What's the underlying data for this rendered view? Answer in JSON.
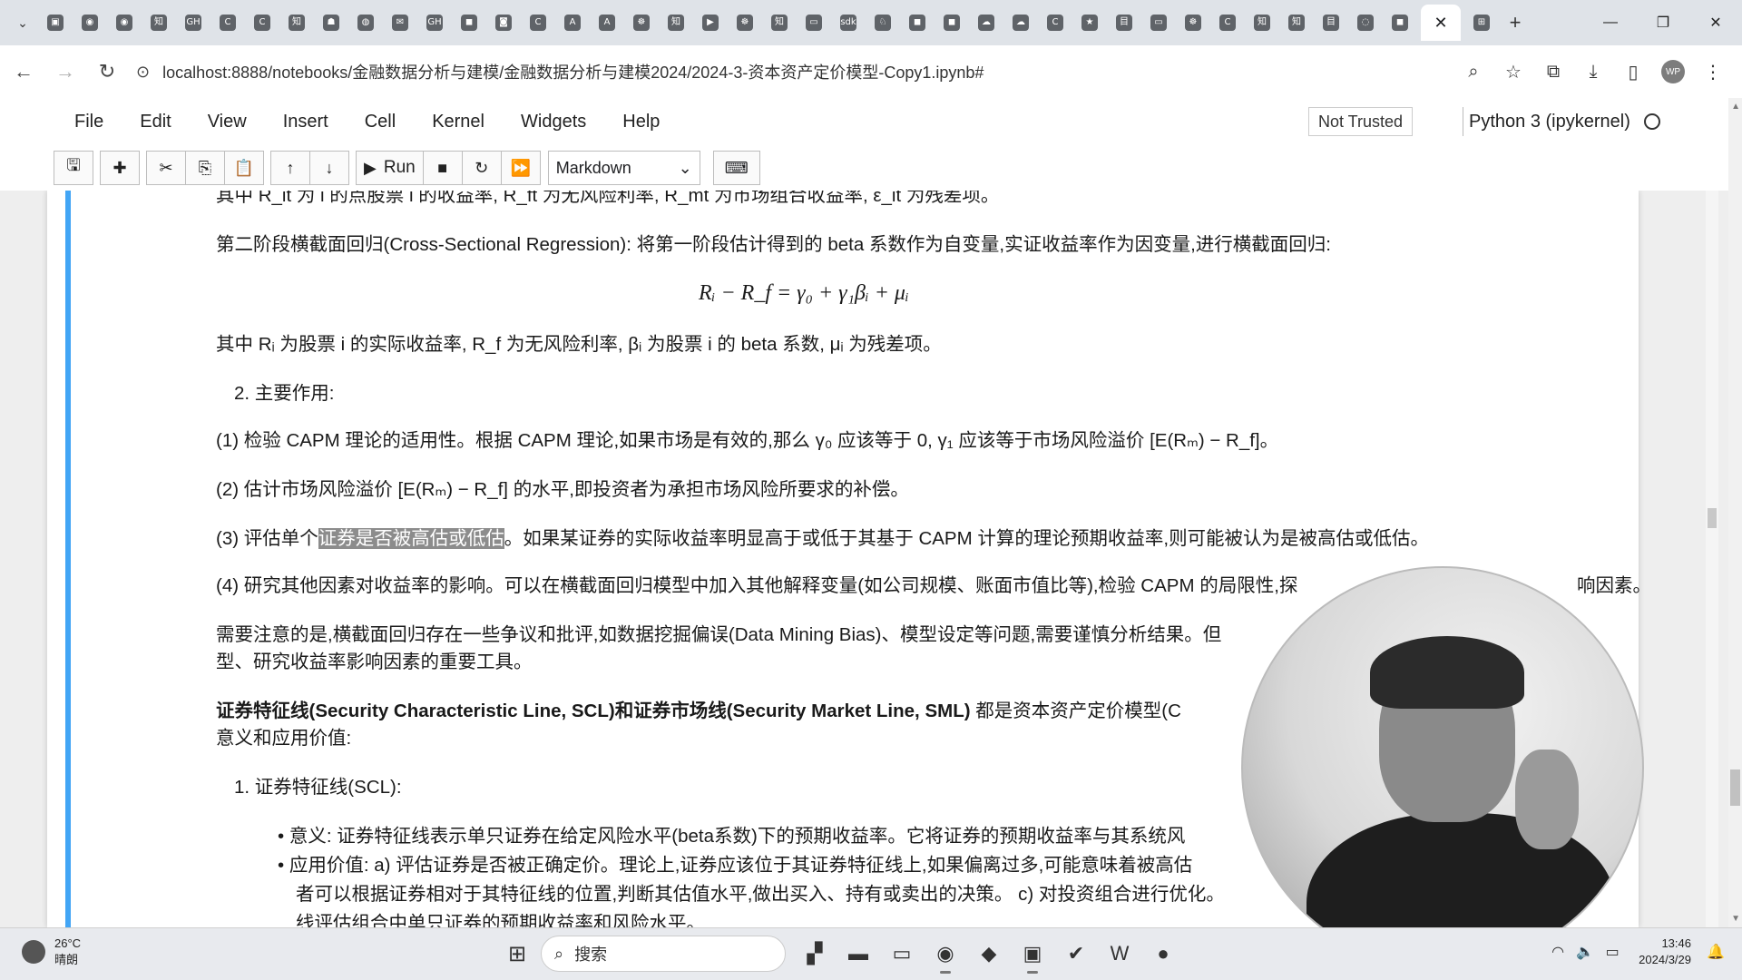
{
  "browser": {
    "tab_icons": [
      "▾",
      "▣",
      "◉",
      "◉",
      "知",
      "GH",
      "C",
      "C",
      "知",
      "☗",
      "◍",
      "✉",
      "GH",
      "◼",
      "◙",
      "C",
      "A",
      "A",
      "☸",
      "知",
      "▶",
      "☸",
      "知",
      "▭",
      "sdk",
      "♘",
      "◼",
      "◼",
      "☁",
      "☁",
      "C",
      "★",
      "目",
      "▭",
      "☸",
      "C",
      "知",
      "知",
      "目",
      "◌",
      "◼"
    ],
    "active_tab_close": "✕",
    "new_tab": "+",
    "window_controls": [
      "—",
      "❐",
      "✕"
    ],
    "url": "localhost:8888/notebooks/金融数据分析与建模/金融数据分析与建模2024/2024-3-资本资产定价模型-Copy1.ipynb#",
    "nav_back": "←",
    "nav_forward": "→",
    "nav_reload": "↻"
  },
  "menu": {
    "items": [
      "File",
      "Edit",
      "View",
      "Insert",
      "Cell",
      "Kernel",
      "Widgets",
      "Help"
    ],
    "trusted_label": "Not Trusted",
    "kernel_label": "Python 3 (ipykernel)"
  },
  "toolbar": {
    "run_label": "Run",
    "cell_type": "Markdown"
  },
  "content": {
    "line0": "其中 R_it 为 i 的点股票 i 的收益率, R_ft 为无风险利率, R_mt 为市场组合收益率, ε_it 为残差项。",
    "line1": "第二阶段横截面回归(Cross-Sectional Regression): 将第一阶段估计得到的 beta 系数作为自变量,实证收益率作为因变量,进行横截面回归:",
    "equation": "Rᵢ − R_f = γ₀ + γ₁βᵢ + μᵢ",
    "line2": "其中 Rᵢ 为股票 i 的实际收益率, R_f 为无风险利率, βᵢ 为股票 i 的 beta 系数, μᵢ 为残差项。",
    "line3": "2. 主要作用:",
    "line4": "(1) 检验 CAPM 理论的适用性。根据 CAPM 理论,如果市场是有效的,那么 γ₀ 应该等于 0, γ₁ 应该等于市场风险溢价 [E(Rₘ) − R_f]。",
    "line5": "(2) 估计市场风险溢价 [E(Rₘ) − R_f] 的水平,即投资者为承担市场风险所要求的补偿。",
    "line6_pre": "(3) 评估单个",
    "line6_hl": "证券是否被高估或低估",
    "line6_post": "。如果某证券的实际收益率明显高于或低于其基于 CAPM 计算的理论预期收益率,则可能被认为是被高估或低估。",
    "line7": "(4) 研究其他因素对收益率的影响。可以在横截面回归模型中加入其他解释变量(如公司规模、账面市值比等),检验 CAPM 的局限性,探",
    "line7_tail": "响因素。",
    "line8": "需要注意的是,横截面回归存在一些争议和批评,如数据挖掘偏误(Data Mining Bias)、模型设定等问题,需要谨慎分析结果。但",
    "line8b": "型、研究收益率影响因素的重要工具。",
    "line9_bold": "证券特征线(Security Characteristic Line, SCL)和证券市场线(Security Market Line, SML)",
    "line9_rest": " 都是资本资产定价模型(C",
    "line9b": "意义和应用价值:",
    "line10": "1. 证券特征线(SCL):",
    "bullet1": "意义: 证券特征线表示单只证券在给定风险水平(beta系数)下的预期收益率。它将证券的预期收益率与其系统风",
    "bullet2": "应用价值: a) 评估证券是否被正确定价。理论上,证券应该位于其证券特征线上,如果偏离过多,可能意味着被高估",
    "bullet2b": "者可以根据证券相对于其特征线的位置,判断其估值水平,做出买入、持有或卖出的决策。 c) 对投资组合进行优化。",
    "bullet2c": "线评估组合中单只证券的预期收益率和风险水平。"
  },
  "taskbar": {
    "temperature": "26°C",
    "weather": "晴朗",
    "search_placeholder": "搜索",
    "time": "13:46",
    "date": "2024/3/29"
  }
}
